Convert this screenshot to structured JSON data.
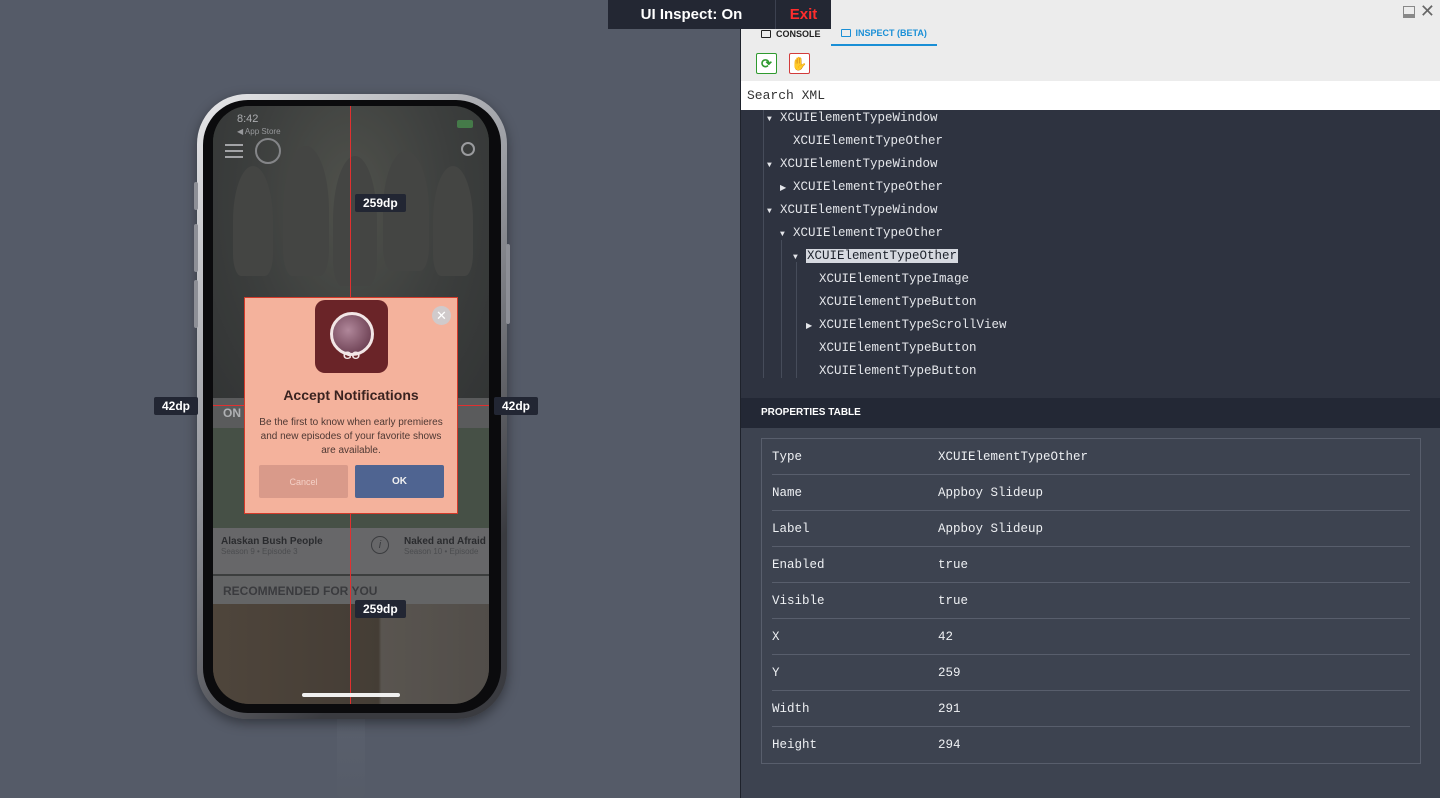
{
  "topbar": {
    "state": "UI Inspect: On",
    "exit": "Exit"
  },
  "device": {
    "status_time": "8:42",
    "back_label": "◀ App Store",
    "section_label": "ON",
    "card_left_title": "Alaskan Bush People",
    "card_left_sub": "Season 9 • Episode 3",
    "card_right_title": "Naked and Afraid",
    "card_right_sub": "Season 10 • Episode",
    "recommended": "RECOMMENDED FOR YOU"
  },
  "modal": {
    "logo_text": "Discovery",
    "logo_go": "GO",
    "title": "Accept Notifications",
    "body": "Be the first to know when early premieres and new episodes of your favorite shows are available.",
    "cancel": "Cancel",
    "ok": "OK",
    "close_glyph": "✕"
  },
  "measure": {
    "top": "259dp",
    "bottom": "259dp",
    "left": "42dp",
    "right": "42dp"
  },
  "panel": {
    "tabs": [
      {
        "label": "CONSOLE",
        "active": false
      },
      {
        "label": "INSPECT (BETA)",
        "active": true
      }
    ],
    "search_placeholder": "Search XML",
    "tree": [
      "XCUIElementTypeWindow",
      "XCUIElementTypeOther",
      "XCUIElementTypeWindow",
      "XCUIElementTypeOther",
      "XCUIElementTypeWindow",
      "XCUIElementTypeOther",
      "XCUIElementTypeOther",
      "XCUIElementTypeImage",
      "XCUIElementTypeButton",
      "XCUIElementTypeScrollView",
      "XCUIElementTypeButton",
      "XCUIElementTypeButton"
    ],
    "properties_title": "PROPERTIES TABLE",
    "properties": [
      {
        "key": "Type",
        "value": "XCUIElementTypeOther"
      },
      {
        "key": "Name",
        "value": "Appboy Slideup"
      },
      {
        "key": "Label",
        "value": "Appboy Slideup"
      },
      {
        "key": "Enabled",
        "value": "true"
      },
      {
        "key": "Visible",
        "value": "true"
      },
      {
        "key": "X",
        "value": "42"
      },
      {
        "key": "Y",
        "value": "259"
      },
      {
        "key": "Width",
        "value": "291"
      },
      {
        "key": "Height",
        "value": "294"
      }
    ]
  },
  "colors": {
    "accent": "#1a8fd6",
    "exit": "#ff2d2d",
    "guide_red": "#e03030",
    "modal_bg": "#f4b29c",
    "ok_button": "#4f6491"
  }
}
